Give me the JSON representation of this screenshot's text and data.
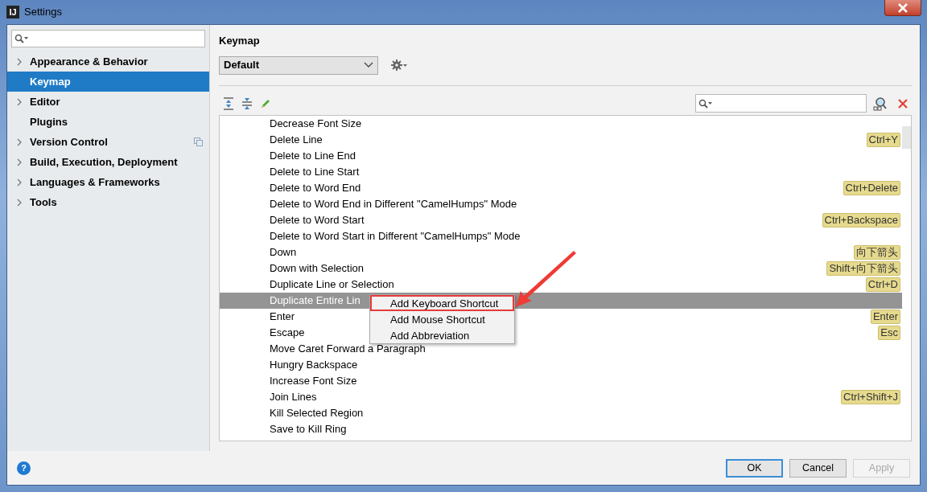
{
  "window": {
    "title": "Settings",
    "logo": "IJ"
  },
  "sidebar": {
    "items": [
      {
        "label": "Appearance & Behavior",
        "expandable": true,
        "selected": false,
        "project_level": false
      },
      {
        "label": "Keymap",
        "expandable": false,
        "selected": true,
        "project_level": false
      },
      {
        "label": "Editor",
        "expandable": true,
        "selected": false,
        "project_level": false
      },
      {
        "label": "Plugins",
        "expandable": false,
        "selected": false,
        "project_level": false
      },
      {
        "label": "Version Control",
        "expandable": true,
        "selected": false,
        "project_level": true
      },
      {
        "label": "Build, Execution, Deployment",
        "expandable": true,
        "selected": false,
        "project_level": false
      },
      {
        "label": "Languages & Frameworks",
        "expandable": true,
        "selected": false,
        "project_level": false
      },
      {
        "label": "Tools",
        "expandable": true,
        "selected": false,
        "project_level": false
      }
    ]
  },
  "panel": {
    "title": "Keymap",
    "keymap": "Default",
    "actions": {
      "rows": [
        {
          "name": "Decrease Font Size",
          "selected": false
        },
        {
          "name": "Delete Line",
          "shortcut": "Ctrl+Y",
          "selected": false
        },
        {
          "name": "Delete to Line End",
          "selected": false
        },
        {
          "name": "Delete to Line Start",
          "selected": false
        },
        {
          "name": "Delete to Word End",
          "shortcut": "Ctrl+Delete",
          "selected": false
        },
        {
          "name": "Delete to Word End in Different \"CamelHumps\" Mode",
          "selected": false
        },
        {
          "name": "Delete to Word Start",
          "shortcut": "Ctrl+Backspace",
          "selected": false
        },
        {
          "name": "Delete to Word Start in Different \"CamelHumps\" Mode",
          "selected": false
        },
        {
          "name": "Down",
          "shortcut": "向下箭头",
          "selected": false
        },
        {
          "name": "Down with Selection",
          "shortcut": "Shift+向下箭头",
          "selected": false
        },
        {
          "name": "Duplicate Line or Selection",
          "shortcut": "Ctrl+D",
          "selected": false
        },
        {
          "name": "Duplicate Entire Lin",
          "selected": true
        },
        {
          "name": "Enter",
          "shortcut": "Enter",
          "selected": false
        },
        {
          "name": "Escape",
          "shortcut": "Esc",
          "selected": false
        },
        {
          "name": "Move Caret Forward a Paragraph",
          "selected": false
        },
        {
          "name": "Hungry Backspace",
          "selected": false
        },
        {
          "name": "Increase Font Size",
          "selected": false
        },
        {
          "name": "Join Lines",
          "shortcut": "Ctrl+Shift+J",
          "selected": false
        },
        {
          "name": "Kill Selected Region",
          "selected": false
        },
        {
          "name": "Save to Kill Ring",
          "selected": false
        }
      ]
    },
    "context_menu": {
      "items": [
        {
          "label": "Add Keyboard Shortcut",
          "annotated": true
        },
        {
          "label": "Add Mouse Shortcut",
          "annotated": false
        },
        {
          "label": "Add Abbreviation",
          "annotated": false
        }
      ]
    }
  },
  "footer": {
    "help": "?",
    "buttons": [
      {
        "label": "OK",
        "kind": "default"
      },
      {
        "label": "Cancel",
        "kind": "normal"
      },
      {
        "label": "Apply",
        "kind": "disabled"
      }
    ]
  }
}
